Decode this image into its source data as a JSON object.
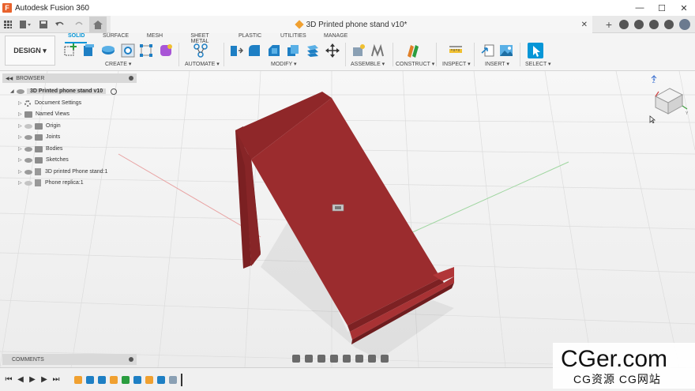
{
  "window": {
    "app_title": "Autodesk Fusion 360",
    "logo_letter": "F",
    "controls": [
      "—",
      "☐",
      "✕"
    ]
  },
  "doc_tab": {
    "title": "3D Printed phone stand v10*",
    "close": "✕"
  },
  "ribbon": {
    "workspace": "DESIGN ▾",
    "tabs": [
      "SOLID",
      "SURFACE",
      "MESH",
      "SHEET METAL",
      "PLASTIC",
      "UTILITIES",
      "MANAGE"
    ],
    "active_tab": "SOLID",
    "groups": [
      {
        "label": "CREATE ▾",
        "tools": [
          "new-sketch-icon",
          "extrude-icon",
          "revolve-icon",
          "hole-icon",
          "pattern-icon",
          "create-form-icon"
        ]
      },
      {
        "label": "AUTOMATE ▾",
        "tools": [
          "automate-icon"
        ]
      },
      {
        "label": "MODIFY ▾",
        "tools": [
          "press-pull-icon",
          "fillet-icon",
          "chamfer-icon",
          "shell-icon",
          "combine-icon",
          "move-icon"
        ]
      },
      {
        "label": "ASSEMBLE ▾",
        "tools": [
          "new-component-icon",
          "joint-icon"
        ]
      },
      {
        "label": "CONSTRUCT ▾",
        "tools": [
          "offset-plane-icon"
        ]
      },
      {
        "label": "INSPECT ▾",
        "tools": [
          "measure-icon"
        ]
      },
      {
        "label": "INSERT ▾",
        "tools": [
          "insert-derive-icon",
          "insert-image-icon"
        ]
      },
      {
        "label": "SELECT ▾",
        "tools": [
          "select-icon"
        ]
      }
    ],
    "accent": "#0696d7"
  },
  "browser": {
    "title": "BROWSER",
    "root": "3D Printed phone stand v10",
    "items": [
      {
        "label": "Document Settings",
        "icon": "gear-icon"
      },
      {
        "label": "Named Views",
        "icon": "folder-icon"
      },
      {
        "label": "Origin",
        "icon": "folder-icon"
      },
      {
        "label": "Joints",
        "icon": "folder-icon"
      },
      {
        "label": "Bodies",
        "icon": "folder-icon"
      },
      {
        "label": "Sketches",
        "icon": "folder-icon"
      },
      {
        "label": "3D printed Phone stand:1",
        "icon": "component-icon"
      },
      {
        "label": "Phone replica:1",
        "icon": "component-icon"
      }
    ]
  },
  "model": {
    "color": "#9b2c2e"
  },
  "comments": {
    "title": "COMMENTS"
  },
  "timeline": {
    "controls": [
      "⏮",
      "◀",
      "▶",
      "▶",
      "⏭"
    ]
  },
  "watermark": {
    "main": "CGer.com",
    "sub": "CG资源 CG网站"
  }
}
